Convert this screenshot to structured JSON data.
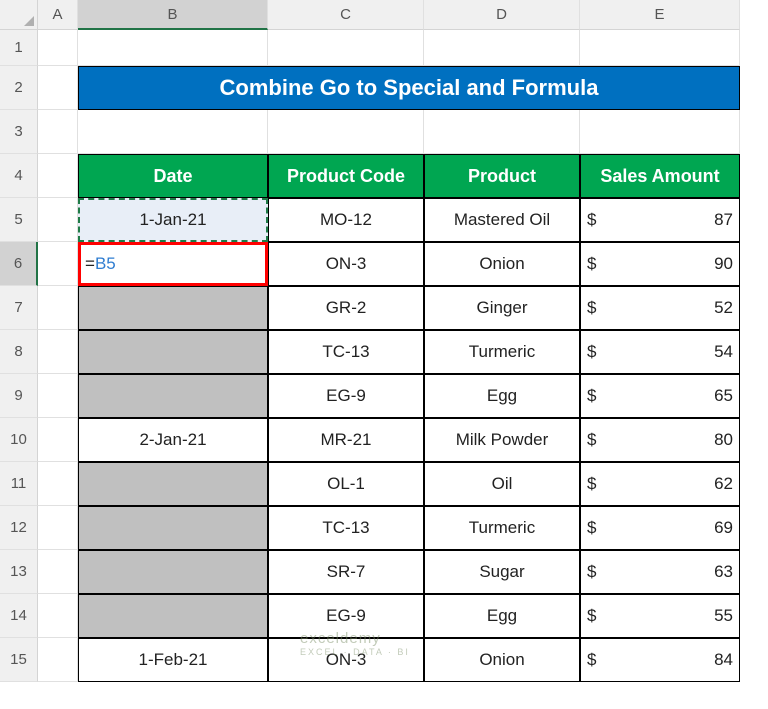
{
  "columns": [
    "A",
    "B",
    "C",
    "D",
    "E"
  ],
  "rows": [
    "1",
    "2",
    "3",
    "4",
    "5",
    "6",
    "7",
    "8",
    "9",
    "10",
    "11",
    "12",
    "13",
    "14",
    "15"
  ],
  "title": "Combine Go to Special and Formula",
  "headers": {
    "date": "Date",
    "code": "Product Code",
    "product": "Product",
    "amount": "Sales Amount"
  },
  "b5": "1-Jan-21",
  "b6_formula": {
    "eq": "=",
    "ref": "B5"
  },
  "chart_data": {
    "type": "table",
    "columns": [
      "Date",
      "Product Code",
      "Product",
      "Sales Amount"
    ],
    "rows": [
      {
        "date": "1-Jan-21",
        "code": "MO-12",
        "product": "Mastered Oil",
        "amount": 87
      },
      {
        "date": "",
        "code": "ON-3",
        "product": "Onion",
        "amount": 90
      },
      {
        "date": "",
        "code": "GR-2",
        "product": "Ginger",
        "amount": 52
      },
      {
        "date": "",
        "code": "TC-13",
        "product": "Turmeric",
        "amount": 54
      },
      {
        "date": "",
        "code": "EG-9",
        "product": "Egg",
        "amount": 65
      },
      {
        "date": "2-Jan-21",
        "code": "MR-21",
        "product": "Milk Powder",
        "amount": 80
      },
      {
        "date": "",
        "code": "OL-1",
        "product": "Oil",
        "amount": 62
      },
      {
        "date": "",
        "code": "TC-13",
        "product": "Turmeric",
        "amount": 69
      },
      {
        "date": "",
        "code": "SR-7",
        "product": "Sugar",
        "amount": 63
      },
      {
        "date": "",
        "code": "EG-9",
        "product": "Egg",
        "amount": 55
      },
      {
        "date": "1-Feb-21",
        "code": "ON-3",
        "product": "Onion",
        "amount": 84
      }
    ]
  },
  "currency": "$",
  "watermark": {
    "main": "exceldemy",
    "sub": "EXCEL · DATA · BI"
  }
}
